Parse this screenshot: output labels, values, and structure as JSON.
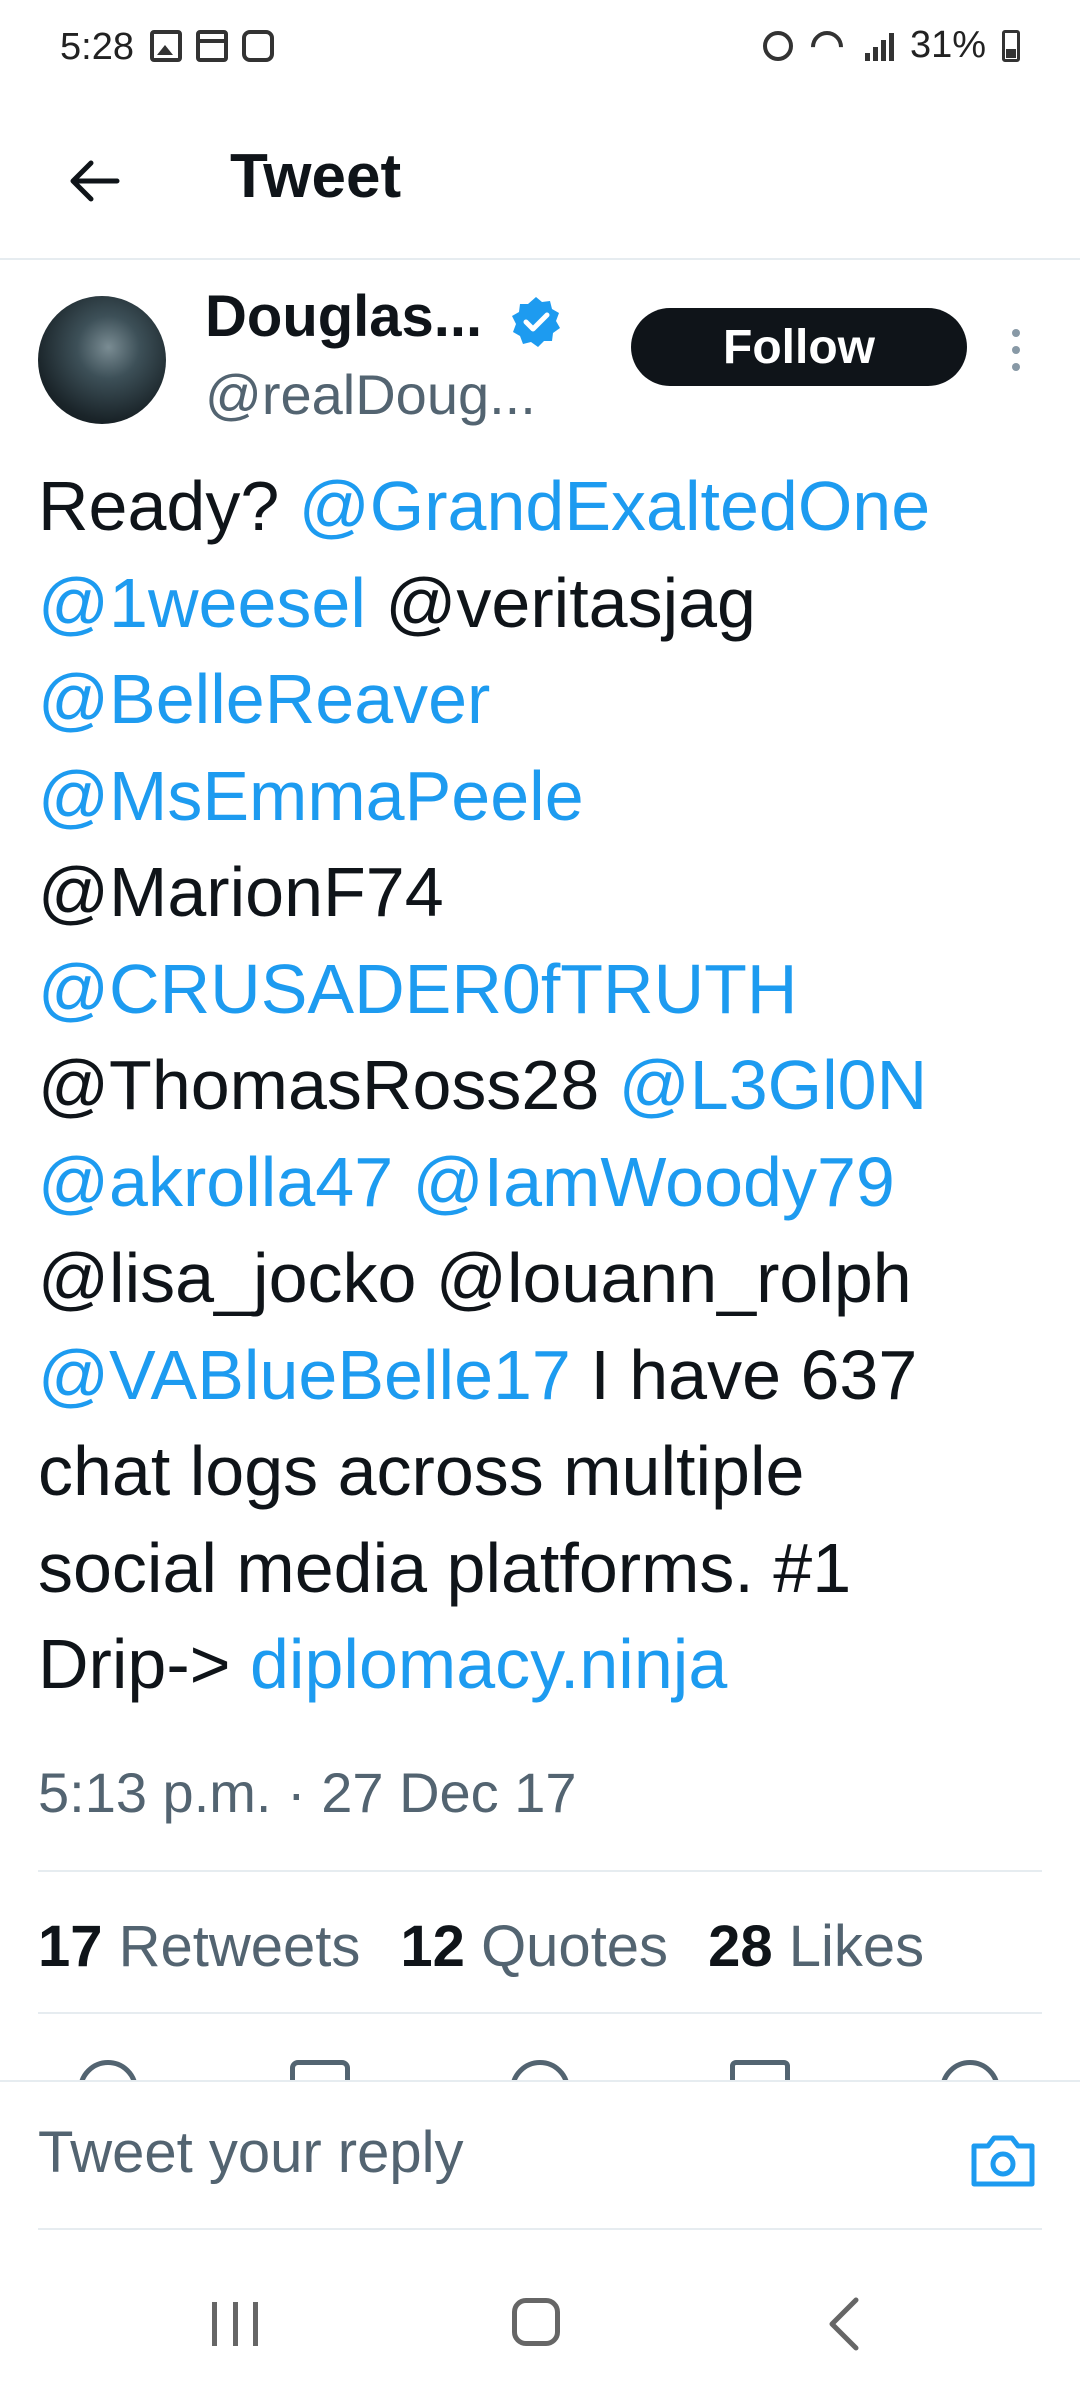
{
  "status_bar": {
    "time": "5:28",
    "battery": "31%",
    "left_icons": [
      "image-icon",
      "calendar-icon",
      "voicemail-icon"
    ],
    "right_icons": [
      "alarm-icon",
      "wifi-icon",
      "signal-icon",
      "battery-icon"
    ]
  },
  "header": {
    "title": "Tweet"
  },
  "author": {
    "name": "Douglas...",
    "handle": "@realDoug...",
    "verified": true,
    "follow_label": "Follow"
  },
  "tweet": {
    "lines": [
      [
        {
          "text": "Ready? ",
          "type": "text"
        },
        {
          "text": "@GrandExaltedOne",
          "type": "link"
        }
      ],
      [
        {
          "text": "@1weesel",
          "type": "link"
        },
        {
          "text": " @veritasjag",
          "type": "text"
        }
      ],
      [
        {
          "text": "@BelleReaver",
          "type": "link"
        }
      ],
      [
        {
          "text": "@MsEmmaPeele",
          "type": "link"
        }
      ],
      [
        {
          "text": "@MarionF74",
          "type": "text"
        }
      ],
      [
        {
          "text": "@CRUSADER0fTRUTH",
          "type": "link"
        }
      ],
      [
        {
          "text": "@ThomasRoss28 ",
          "type": "text"
        },
        {
          "text": "@L3Gl0N",
          "type": "link"
        }
      ],
      [
        {
          "text": "@akrolla47",
          "type": "link"
        },
        {
          "text": " ",
          "type": "text"
        },
        {
          "text": "@IamWoody79",
          "type": "link"
        }
      ],
      [
        {
          "text": "@lisa_jocko @louann_rolph",
          "type": "text"
        }
      ],
      [
        {
          "text": "@VABlueBelle17",
          "type": "link"
        },
        {
          "text": " I have 637",
          "type": "text"
        }
      ],
      [
        {
          "text": "chat logs across multiple",
          "type": "text"
        }
      ],
      [
        {
          "text": "social media platforms. #1",
          "type": "text"
        }
      ],
      [
        {
          "text": "Drip-> ",
          "type": "text"
        },
        {
          "text": "diplomacy.ninja",
          "type": "link"
        }
      ]
    ],
    "timestamp": "5:13 p.m. · 27 Dec 17"
  },
  "stats": {
    "retweets_count": "17",
    "retweets_label": "Retweets",
    "quotes_count": "12",
    "quotes_label": "Quotes",
    "likes_count": "28",
    "likes_label": "Likes"
  },
  "reply": {
    "placeholder": "Tweet your reply"
  },
  "colors": {
    "link": "#1d9bf0",
    "text": "#0f1419",
    "secondary": "#536471",
    "follow_bg": "#0f1419"
  }
}
